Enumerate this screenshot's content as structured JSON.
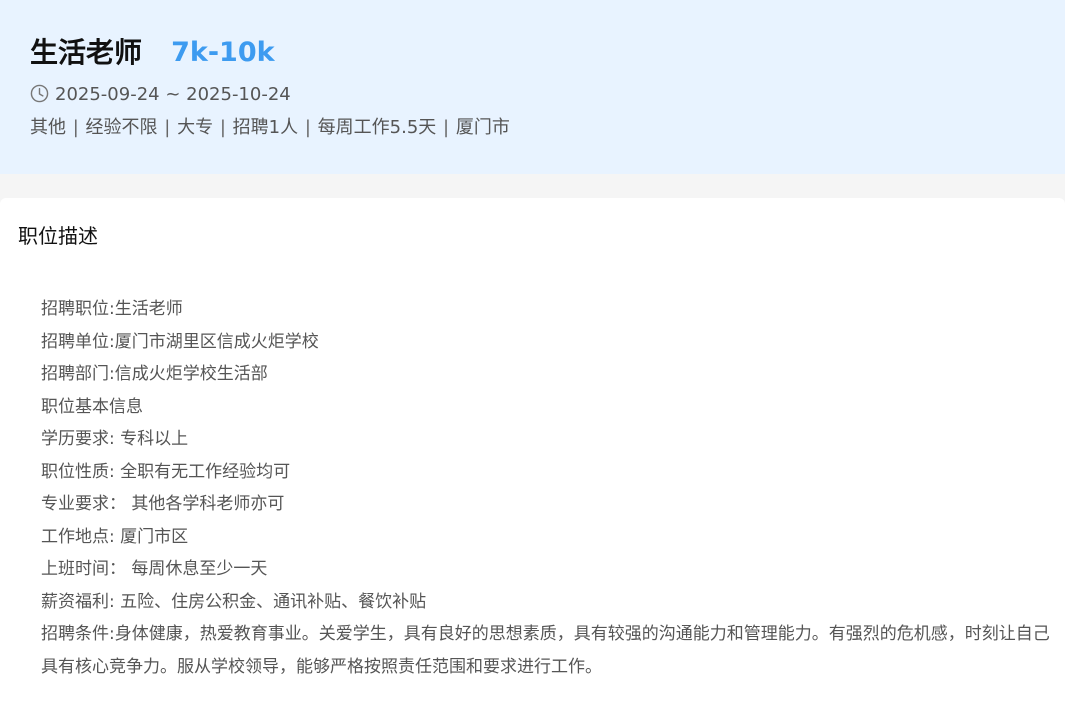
{
  "header": {
    "title": "生活老师",
    "salary": "7k-10k",
    "date_range": "2025-09-24 ~ 2025-10-24",
    "tags": [
      "其他",
      "经验不限",
      "大专",
      "招聘1人",
      "每周工作5.5天",
      "厦门市"
    ],
    "tag_separator": "|",
    "date_icon": "clock-icon"
  },
  "description": {
    "section_title": "职位描述",
    "lines": [
      "招聘职位:生活老师",
      "招聘单位:厦门市湖里区信成火炬学校",
      "招聘部门:信成火炬学校生活部",
      "职位基本信息",
      "学历要求: 专科以上",
      "职位性质: 全职有无工作经验均可",
      "专业要求：  其他各学科老师亦可",
      "工作地点: 厦门市区",
      "上班时间：  每周休息至少一天",
      "薪资福利: 五险、住房公积金、通讯补贴、餐饮补贴",
      "招聘条件:身体健康，热爱教育事业。关爱学生，具有良好的思想素质，具有较强的沟通能力和管理能力。有强烈的危机感，时刻让自己具有核心竞争力。服从学校领导，能够严格按照责任范围和要求进行工作。"
    ]
  },
  "colors": {
    "header_bg": "#e8f3ff",
    "salary": "#3d9bf0",
    "page_bg": "#f5f5f5",
    "card_bg": "#ffffff"
  }
}
